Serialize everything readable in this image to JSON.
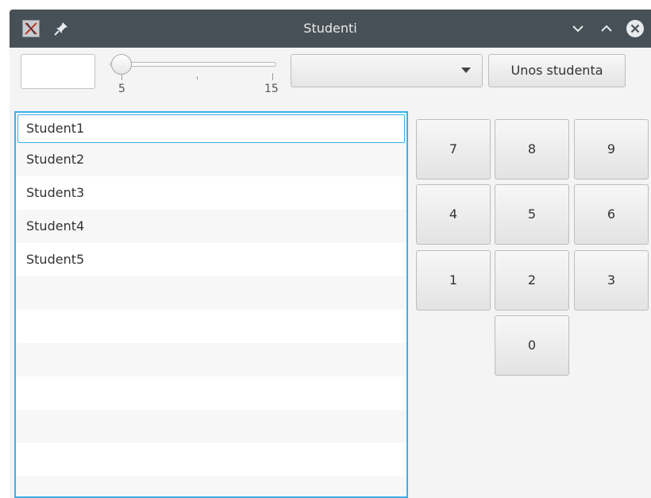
{
  "window": {
    "title": "Studenti"
  },
  "toolbar": {
    "text_field_value": "",
    "slider": {
      "min": 5,
      "max": 15,
      "value": 5,
      "min_label": "5",
      "max_label": "15"
    },
    "combo_value": "",
    "add_button_label": "Unos studenta"
  },
  "students": [
    {
      "name": "Student1"
    },
    {
      "name": "Student2"
    },
    {
      "name": "Student3"
    },
    {
      "name": "Student4"
    },
    {
      "name": "Student5"
    }
  ],
  "keypad": {
    "keys": [
      "7",
      "8",
      "9",
      "4",
      "5",
      "6",
      "1",
      "2",
      "3",
      "0"
    ]
  },
  "colors": {
    "titlebar": "#475057",
    "focus_accent": "#3daee9",
    "client_background": "#f4f4f4"
  }
}
